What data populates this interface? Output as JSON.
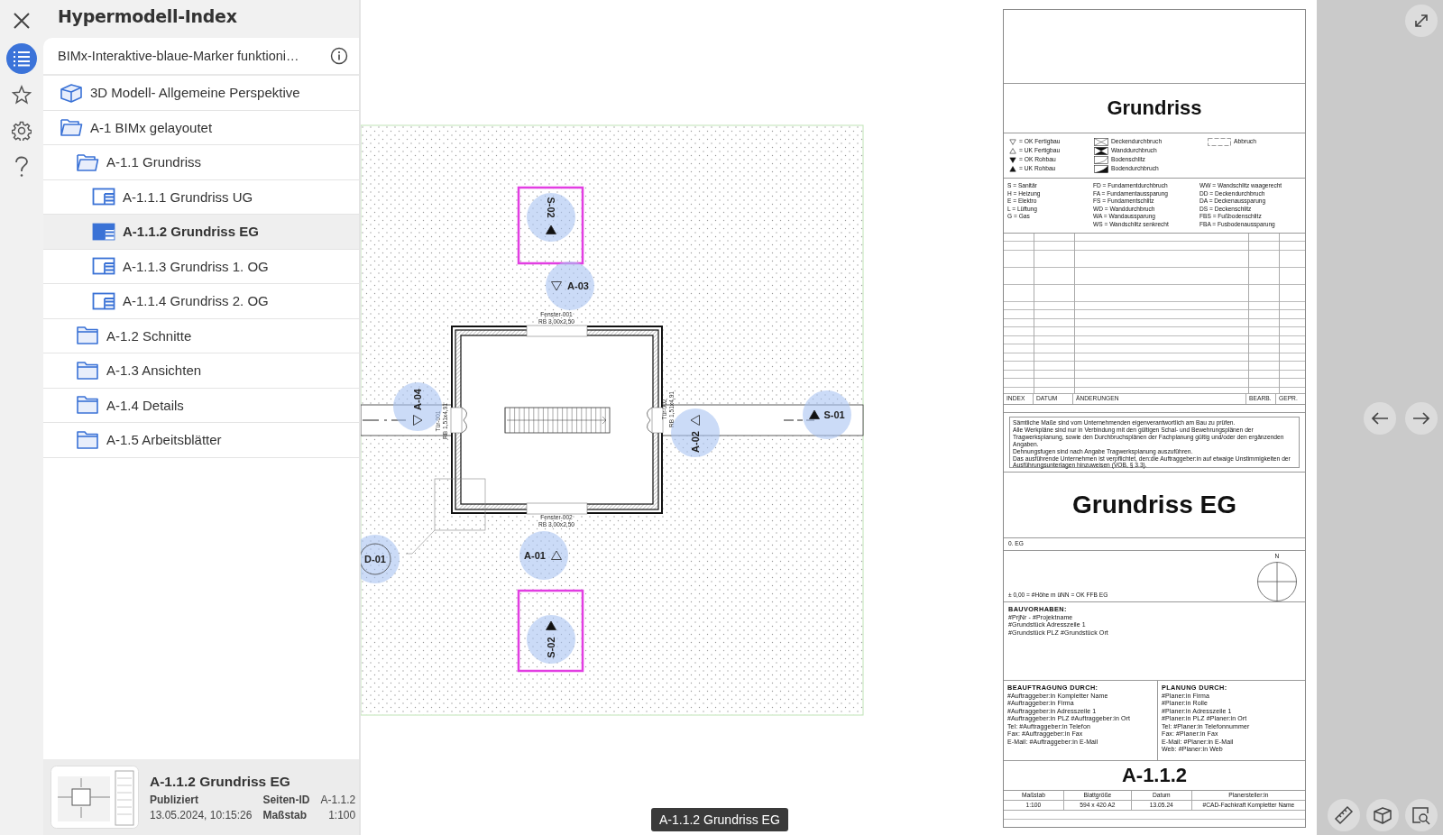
{
  "rail_tabs": [
    {
      "kind": "index",
      "selected": true
    },
    {
      "kind": "favorites",
      "selected": false
    },
    {
      "kind": "settings",
      "selected": false
    },
    {
      "kind": "help",
      "selected": false
    }
  ],
  "sidebar": {
    "title": "Hypermodell-Index",
    "project": "BIMx-Interaktive-blaue-Marker funktioni…",
    "items": [
      {
        "kind": "model",
        "label": "3D Modell- Allgemeine Perspektive",
        "selected": false
      },
      {
        "kind": "folder",
        "label": "A-1 BIMx gelayoutet",
        "selected": false,
        "expanded": true,
        "children": [
          {
            "kind": "folder",
            "label": "A-1.1 Grundriss",
            "selected": false,
            "expanded": true,
            "children": [
              {
                "kind": "sheet",
                "label": "A-1.1.1 Grundriss UG",
                "selected": false
              },
              {
                "kind": "sheet",
                "label": "A-1.1.2 Grundriss EG",
                "selected": true
              },
              {
                "kind": "sheet",
                "label": "A-1.1.3 Grundriss 1. OG",
                "selected": false
              },
              {
                "kind": "sheet",
                "label": "A-1.1.4 Grundriss 2. OG",
                "selected": false
              }
            ]
          },
          {
            "kind": "folder",
            "label": "A-1.2 Schnitte",
            "selected": false,
            "expanded": false
          },
          {
            "kind": "folder",
            "label": "A-1.3 Ansichten",
            "selected": false,
            "expanded": false
          },
          {
            "kind": "folder",
            "label": "A-1.4 Details",
            "selected": false,
            "expanded": false
          },
          {
            "kind": "folder",
            "label": "A-1.5 Arbeitsblätter",
            "selected": false,
            "expanded": false
          }
        ]
      }
    ]
  },
  "preview": {
    "title": "A-1.1.2 Grundriss EG",
    "status": "Publiziert",
    "date": "13.05.2024, 10:15:26",
    "fields": [
      {
        "label": "Seiten-ID",
        "value": "A-1.1.2"
      },
      {
        "label": "Maßstab",
        "value": "1:100"
      }
    ]
  },
  "plan": {
    "markers": [
      {
        "label": "S-02",
        "kind": "uk-rohbau",
        "highlighted": true
      },
      {
        "label": "A-03",
        "kind": "ok-fertigbau",
        "highlighted": false
      },
      {
        "label": "A-04",
        "kind": "ok-fertigbau",
        "highlighted": false
      },
      {
        "label": "A-02",
        "kind": "uk-fertigbau",
        "highlighted": false
      },
      {
        "label": "S-01",
        "kind": "uk-rohbau",
        "highlighted": false
      },
      {
        "label": "A-01",
        "kind": "uk-fertigbau",
        "highlighted": false
      },
      {
        "label": "D-01",
        "kind": "detail",
        "highlighted": false
      },
      {
        "label": "S-02",
        "kind": "uk-rohbau",
        "highlighted": true
      }
    ],
    "labels": [
      "Fenster-001",
      "RB 3,00x2,50",
      "Fenster-002",
      "RB 3,00x2,50",
      "Tür-001",
      "RB 1,51x4,91",
      "Tür-002",
      "RB 1,51x4,91"
    ]
  },
  "title_block": {
    "heading": "Grundriss",
    "legend_symbols": [
      {
        "kind": "ok-fertigbau",
        "label": "= OK Fertigbau"
      },
      {
        "kind": "uk-fertigbau",
        "label": "= UK Fertigbau"
      },
      {
        "kind": "ok-rohbau",
        "label": "= OK Rohbau"
      },
      {
        "kind": "uk-rohbau",
        "label": "= UK Rohbau"
      }
    ],
    "legend_openings": [
      {
        "kind": "deckendurchbruch",
        "label": "Deckendurchbruch"
      },
      {
        "kind": "wanddurchbruch",
        "label": "Wanddurchbruch"
      },
      {
        "kind": "bodenschlitz",
        "label": "Bodenschlitz"
      },
      {
        "kind": "bodendurchbruch",
        "label": "Bodendurchbruch"
      }
    ],
    "legend_demolition": "Abbruch",
    "abbreviations": [
      [
        "S = Sanitär",
        "H = Heizung",
        "E = Elektro",
        "L = Lüftung",
        "G = Gas"
      ],
      [
        "FD = Fundamentdurchbruch",
        "FA = Fundamentaussparung",
        "FS = Fundamentschlitz",
        "WD = Wanddurchbruch",
        "WA = Wandaussparung",
        "WS = Wandschlitz senkrecht"
      ],
      [
        "WW = Wandschlitz waagerecht",
        "DD = Deckendurchbruch",
        "DA = Deckenaussparung",
        "DS = Deckenschlitz",
        "FBS = Fußbodenschlitz",
        "FBA = Fusbodenaussparung"
      ]
    ],
    "revision_columns": [
      "INDEX",
      "DATUM",
      "ÄNDERUNGEN",
      "BEARB.",
      "GEPR."
    ],
    "notes": [
      "Sämtliche Maße sind vom Unternehmenden eigenverantwortlich am Bau zu prüfen.",
      "Alle Werkpläne sind nur in Verbindung mit den gültigen Schal- und Bewehrungsplänen der Tragwerksplanung, sowie den Durchbruchsplänen der Fachplanung gültig und/oder den ergänzenden Angaben.",
      "Dehnungsfugen sind nach Angabe Tragwerksplanung auszuführen.",
      "Das ausführende Unternehmen ist verpflichtet, den:die Auftraggeber:in auf etwaige Unstimmigkeiten der Ausführungsunterlagen hinzuweisen (VOB, § 3.3)."
    ],
    "sheet_name": "Grundriss EG",
    "storey": "0. EG",
    "north": "N",
    "height_reference": "± 0,00 = #Höhe m üNN = OK FFB EG",
    "project": {
      "heading": "BAUVORHABEN:",
      "lines": [
        "#PrjNr - #Projektname",
        "#Grundstück Adresszeile 1",
        "#Grundstück PLZ #Grundstück Ort"
      ]
    },
    "client": {
      "heading": "BEAUFTRAGUNG DURCH:",
      "lines": [
        "#Auftraggeber:in Kompletter Name",
        "#Auftraggeber:in Firma",
        "#Auftraggeber:in Adresszeile 1",
        "#Auftraggeber:in PLZ #Auftraggeber:in Ort",
        "Tel: #Auftraggeber:in Telefon",
        "Fax: #Auftraggeber:in Fax",
        "E-Mail: #Auftraggeber:in E-Mail"
      ]
    },
    "planner": {
      "heading": "PLANUNG DURCH:",
      "lines": [
        "#Planer:in Firma",
        "#Planer:in Rolle",
        "#Planer:in Adresszeile 1",
        "#Planer:in PLZ #Planer:in Ort",
        "Tel: #Planer:in Telefonnummer",
        "Fax: #Planer:in Fax",
        "E-Mail: #Planer:in E-Mail",
        "Web: #Planer:in Web"
      ]
    },
    "sheet_number": "A-1.1.2",
    "info_table": {
      "columns": [
        "Maßstab",
        "Blattgröße",
        "Datum",
        "Planersteller:in"
      ],
      "values": [
        "1:100",
        "594 x 420 A2",
        "13.05.24",
        "#CAD-Fachkraft Kompletter Name"
      ]
    }
  },
  "tooltip": "A-1.1.2 Grundriss EG"
}
